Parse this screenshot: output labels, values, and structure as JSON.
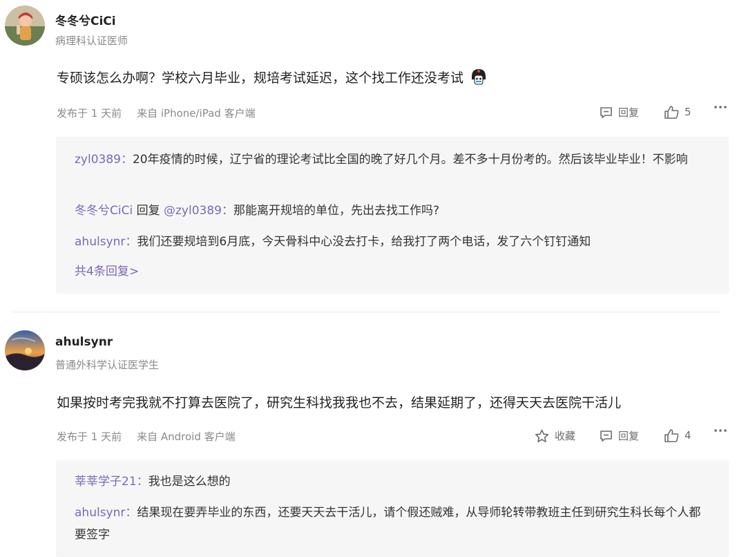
{
  "comments": [
    {
      "username": "冬冬兮CiCi",
      "certification": "病理科认证医师",
      "content": "专硕该怎么办啊？学校六月毕业，规培考试延迟，这个找工作还没考试",
      "posted": "发布于 1 天前",
      "client": "来自 iPhone/iPad 客户端",
      "actions": {
        "reply": "回复",
        "likes": "5"
      },
      "replies": [
        {
          "user": "zyl0389",
          "sep": "：",
          "text": "20年疫情的时候，辽宁省的理论考试比全国的晚了好几个月。差不多十月份考的。然后该毕业毕业！不影响"
        },
        {
          "user": "冬冬兮CiCi",
          "mid": " 回复 ",
          "target": "@zyl0389",
          "sep": "：",
          "text": "那能离开规培的单位，先出去找工作吗?"
        },
        {
          "user": "ahulsynr",
          "sep": "：",
          "text": "我们还要规培到6月底，今天骨科中心没去打卡，给我打了两个电话，发了六个钉钉通知"
        }
      ],
      "more_replies": "共4条回复>"
    },
    {
      "username": "ahulsynr",
      "certification": "普通外科学认证医学生",
      "content": "如果按时考完我就不打算去医院了，研究生科找我我也不去，结果延期了，还得天天去医院干活儿",
      "posted": "发布于 1 天前",
      "client": "来自 Android 客户端",
      "actions": {
        "favorite": "收藏",
        "reply": "回复",
        "likes": "4"
      },
      "replies": [
        {
          "user": "莘莘学子21",
          "sep": "：",
          "text": "我也是这么想的"
        },
        {
          "user": "ahulsynr",
          "sep": "：",
          "text": "结果现在要弄毕业的东西，还要天天去干活儿，请个假还贼难，从导师轮转带教班主任到研究生科长每个人都要签字"
        }
      ]
    }
  ],
  "colors": {
    "username_link": "#7c68b8",
    "reply_bg": "#f6f6f6",
    "muted": "#8a8a8a"
  },
  "icons": [
    "comment-icon",
    "thumbs-up-icon",
    "more-icon",
    "star-icon",
    "emoji-sticker"
  ]
}
